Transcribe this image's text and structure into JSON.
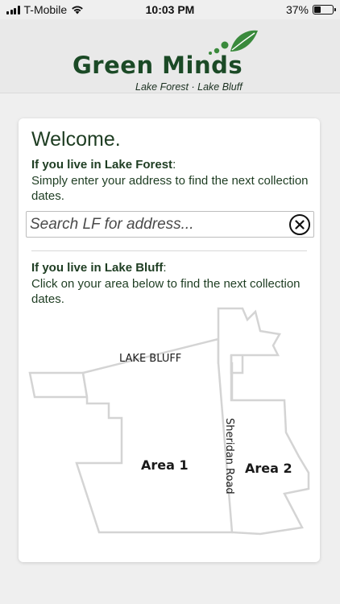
{
  "status_bar": {
    "carrier": "T-Mobile",
    "time": "10:03 PM",
    "battery": "37%",
    "battery_level": 0.37
  },
  "header": {
    "logo_title": "Green Minds",
    "logo_subtitle": "Lake Forest · Lake Bluff"
  },
  "card": {
    "welcome": "Welcome.",
    "lake_forest": {
      "heading": "If you live in Lake Forest",
      "colon": ":",
      "text": "Simply enter your address to find the next collection dates."
    },
    "search": {
      "placeholder": "Search LF for address...",
      "value": ""
    },
    "lake_bluff": {
      "heading": "If you live in Lake Bluff",
      "colon": ":",
      "text": "Click on your area below to find the next collection dates."
    },
    "map": {
      "title": "LAKE BLUFF",
      "area1": "Area 1",
      "area2": "Area 2",
      "road": "Sheridan Road"
    }
  },
  "colors": {
    "brand_green": "#1b4a26",
    "leaf_green": "#3a8a3c",
    "map_outline": "#d4d4d4"
  }
}
